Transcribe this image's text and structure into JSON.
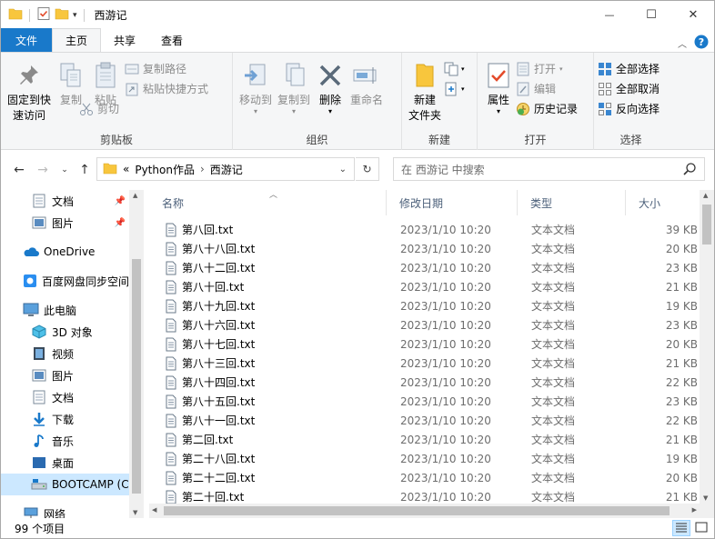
{
  "window": {
    "title": "西游记",
    "minimize": "—",
    "maximize": "☐",
    "close": "✕"
  },
  "tabs": [
    {
      "label": "文件"
    },
    {
      "label": "主页"
    },
    {
      "label": "共享"
    },
    {
      "label": "查看"
    }
  ],
  "ribbon": {
    "clipboard": {
      "label": "剪贴板",
      "pin": "固定到快\n速访问",
      "copy": "复制",
      "paste": "粘贴",
      "copy_path": "复制路径",
      "paste_shortcut": "粘贴快捷方式",
      "cut": "剪切"
    },
    "organize": {
      "label": "组织",
      "move_to": "移动到",
      "copy_to": "复制到",
      "delete": "删除",
      "rename": "重命名"
    },
    "new": {
      "label": "新建",
      "new_folder": "新建\n文件夹"
    },
    "open": {
      "label": "打开",
      "properties": "属性",
      "open": "打开",
      "edit": "编辑",
      "history": "历史记录"
    },
    "select": {
      "label": "选择",
      "select_all": "全部选择",
      "select_none": "全部取消",
      "invert": "反向选择"
    }
  },
  "address": {
    "chevron": "«",
    "crumbs": [
      "Python作品",
      "西游记"
    ],
    "separator": "›"
  },
  "search": {
    "placeholder": "在 西游记 中搜索"
  },
  "nav": {
    "items": [
      {
        "label": "文档"
      },
      {
        "label": "图片"
      },
      {
        "label": "OneDrive"
      },
      {
        "label": "百度网盘同步空间"
      },
      {
        "label": "此电脑"
      },
      {
        "label": "3D 对象"
      },
      {
        "label": "视频"
      },
      {
        "label": "图片"
      },
      {
        "label": "文档"
      },
      {
        "label": "下载"
      },
      {
        "label": "音乐"
      },
      {
        "label": "桌面"
      },
      {
        "label": "BOOTCAMP (C"
      },
      {
        "label": "网络"
      }
    ]
  },
  "columns": {
    "name": "名称",
    "date": "修改日期",
    "type": "类型",
    "size": "大小"
  },
  "files": [
    {
      "name": "第八回.txt",
      "date": "2023/1/10 10:20",
      "type": "文本文档",
      "size": "39 KB"
    },
    {
      "name": "第八十八回.txt",
      "date": "2023/1/10 10:20",
      "type": "文本文档",
      "size": "20 KB"
    },
    {
      "name": "第八十二回.txt",
      "date": "2023/1/10 10:20",
      "type": "文本文档",
      "size": "23 KB"
    },
    {
      "name": "第八十回.txt",
      "date": "2023/1/10 10:20",
      "type": "文本文档",
      "size": "21 KB"
    },
    {
      "name": "第八十九回.txt",
      "date": "2023/1/10 10:20",
      "type": "文本文档",
      "size": "19 KB"
    },
    {
      "name": "第八十六回.txt",
      "date": "2023/1/10 10:20",
      "type": "文本文档",
      "size": "23 KB"
    },
    {
      "name": "第八十七回.txt",
      "date": "2023/1/10 10:20",
      "type": "文本文档",
      "size": "20 KB"
    },
    {
      "name": "第八十三回.txt",
      "date": "2023/1/10 10:20",
      "type": "文本文档",
      "size": "21 KB"
    },
    {
      "name": "第八十四回.txt",
      "date": "2023/1/10 10:20",
      "type": "文本文档",
      "size": "22 KB"
    },
    {
      "name": "第八十五回.txt",
      "date": "2023/1/10 10:20",
      "type": "文本文档",
      "size": "23 KB"
    },
    {
      "name": "第八十一回.txt",
      "date": "2023/1/10 10:20",
      "type": "文本文档",
      "size": "22 KB"
    },
    {
      "name": "第二回.txt",
      "date": "2023/1/10 10:20",
      "type": "文本文档",
      "size": "21 KB"
    },
    {
      "name": "第二十八回.txt",
      "date": "2023/1/10 10:20",
      "type": "文本文档",
      "size": "19 KB"
    },
    {
      "name": "第二十二回.txt",
      "date": "2023/1/10 10:20",
      "type": "文本文档",
      "size": "20 KB"
    },
    {
      "name": "第二十回.txt",
      "date": "2023/1/10 10:20",
      "type": "文本文档",
      "size": "21 KB"
    }
  ],
  "status": {
    "count": "99 个项目"
  },
  "colors": {
    "file_tab": "#1979ca",
    "selected": "#cce8ff",
    "folder": "#f8c63d"
  }
}
